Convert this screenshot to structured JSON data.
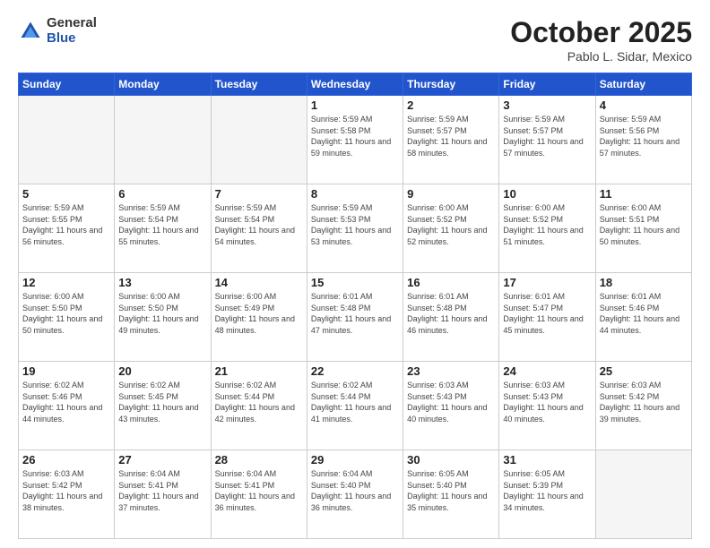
{
  "header": {
    "logo": {
      "general": "General",
      "blue": "Blue"
    },
    "title": "October 2025",
    "location": "Pablo L. Sidar, Mexico"
  },
  "calendar": {
    "weekdays": [
      "Sunday",
      "Monday",
      "Tuesday",
      "Wednesday",
      "Thursday",
      "Friday",
      "Saturday"
    ],
    "weeks": [
      [
        {
          "day": "",
          "empty": true
        },
        {
          "day": "",
          "empty": true
        },
        {
          "day": "",
          "empty": true
        },
        {
          "day": "1",
          "sunrise": "5:59 AM",
          "sunset": "5:58 PM",
          "daylight": "11 hours and 59 minutes."
        },
        {
          "day": "2",
          "sunrise": "5:59 AM",
          "sunset": "5:57 PM",
          "daylight": "11 hours and 58 minutes."
        },
        {
          "day": "3",
          "sunrise": "5:59 AM",
          "sunset": "5:57 PM",
          "daylight": "11 hours and 57 minutes."
        },
        {
          "day": "4",
          "sunrise": "5:59 AM",
          "sunset": "5:56 PM",
          "daylight": "11 hours and 57 minutes."
        }
      ],
      [
        {
          "day": "5",
          "sunrise": "5:59 AM",
          "sunset": "5:55 PM",
          "daylight": "11 hours and 56 minutes."
        },
        {
          "day": "6",
          "sunrise": "5:59 AM",
          "sunset": "5:54 PM",
          "daylight": "11 hours and 55 minutes."
        },
        {
          "day": "7",
          "sunrise": "5:59 AM",
          "sunset": "5:54 PM",
          "daylight": "11 hours and 54 minutes."
        },
        {
          "day": "8",
          "sunrise": "5:59 AM",
          "sunset": "5:53 PM",
          "daylight": "11 hours and 53 minutes."
        },
        {
          "day": "9",
          "sunrise": "6:00 AM",
          "sunset": "5:52 PM",
          "daylight": "11 hours and 52 minutes."
        },
        {
          "day": "10",
          "sunrise": "6:00 AM",
          "sunset": "5:52 PM",
          "daylight": "11 hours and 51 minutes."
        },
        {
          "day": "11",
          "sunrise": "6:00 AM",
          "sunset": "5:51 PM",
          "daylight": "11 hours and 50 minutes."
        }
      ],
      [
        {
          "day": "12",
          "sunrise": "6:00 AM",
          "sunset": "5:50 PM",
          "daylight": "11 hours and 50 minutes."
        },
        {
          "day": "13",
          "sunrise": "6:00 AM",
          "sunset": "5:50 PM",
          "daylight": "11 hours and 49 minutes."
        },
        {
          "day": "14",
          "sunrise": "6:00 AM",
          "sunset": "5:49 PM",
          "daylight": "11 hours and 48 minutes."
        },
        {
          "day": "15",
          "sunrise": "6:01 AM",
          "sunset": "5:48 PM",
          "daylight": "11 hours and 47 minutes."
        },
        {
          "day": "16",
          "sunrise": "6:01 AM",
          "sunset": "5:48 PM",
          "daylight": "11 hours and 46 minutes."
        },
        {
          "day": "17",
          "sunrise": "6:01 AM",
          "sunset": "5:47 PM",
          "daylight": "11 hours and 45 minutes."
        },
        {
          "day": "18",
          "sunrise": "6:01 AM",
          "sunset": "5:46 PM",
          "daylight": "11 hours and 44 minutes."
        }
      ],
      [
        {
          "day": "19",
          "sunrise": "6:02 AM",
          "sunset": "5:46 PM",
          "daylight": "11 hours and 44 minutes."
        },
        {
          "day": "20",
          "sunrise": "6:02 AM",
          "sunset": "5:45 PM",
          "daylight": "11 hours and 43 minutes."
        },
        {
          "day": "21",
          "sunrise": "6:02 AM",
          "sunset": "5:44 PM",
          "daylight": "11 hours and 42 minutes."
        },
        {
          "day": "22",
          "sunrise": "6:02 AM",
          "sunset": "5:44 PM",
          "daylight": "11 hours and 41 minutes."
        },
        {
          "day": "23",
          "sunrise": "6:03 AM",
          "sunset": "5:43 PM",
          "daylight": "11 hours and 40 minutes."
        },
        {
          "day": "24",
          "sunrise": "6:03 AM",
          "sunset": "5:43 PM",
          "daylight": "11 hours and 40 minutes."
        },
        {
          "day": "25",
          "sunrise": "6:03 AM",
          "sunset": "5:42 PM",
          "daylight": "11 hours and 39 minutes."
        }
      ],
      [
        {
          "day": "26",
          "sunrise": "6:03 AM",
          "sunset": "5:42 PM",
          "daylight": "11 hours and 38 minutes."
        },
        {
          "day": "27",
          "sunrise": "6:04 AM",
          "sunset": "5:41 PM",
          "daylight": "11 hours and 37 minutes."
        },
        {
          "day": "28",
          "sunrise": "6:04 AM",
          "sunset": "5:41 PM",
          "daylight": "11 hours and 36 minutes."
        },
        {
          "day": "29",
          "sunrise": "6:04 AM",
          "sunset": "5:40 PM",
          "daylight": "11 hours and 36 minutes."
        },
        {
          "day": "30",
          "sunrise": "6:05 AM",
          "sunset": "5:40 PM",
          "daylight": "11 hours and 35 minutes."
        },
        {
          "day": "31",
          "sunrise": "6:05 AM",
          "sunset": "5:39 PM",
          "daylight": "11 hours and 34 minutes."
        },
        {
          "day": "",
          "empty": true
        }
      ]
    ]
  }
}
